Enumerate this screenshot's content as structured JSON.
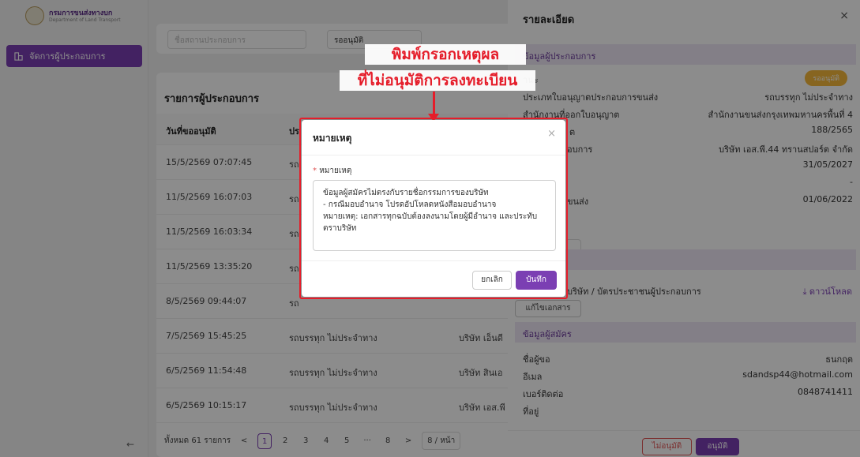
{
  "sidebar": {
    "logo_th": "กรมการขนส่งทางบก",
    "logo_en": "Department of Land Transport",
    "menu_item": "จัดการผู้ประกอบการ",
    "collapse_glyph": "←"
  },
  "filter": {
    "name_placeholder": "ชื่อสถานประกอบการ",
    "status_value": "รออนุมัติ"
  },
  "list": {
    "title": "รายการผู้ประกอบการ",
    "col_date": "วันที่ขออนุมัติ",
    "col_type_partial": "ปร",
    "rows": [
      {
        "date": "15/5/2569 07:07:45",
        "type": "รถ",
        "company": ""
      },
      {
        "date": "11/5/2569 16:07:03",
        "type": "รถ",
        "company": ""
      },
      {
        "date": "11/5/2569 16:03:34",
        "type": "รถ",
        "company": ""
      },
      {
        "date": "11/5/2569 13:35:20",
        "type": "รถ",
        "company": ""
      },
      {
        "date": "8/5/2569 09:44:07",
        "type": "รถ",
        "company": ""
      },
      {
        "date": "7/5/2569 15:45:25",
        "type": "รถบรรทุก ไม่ประจำทาง",
        "company": "บริษัท เอ็นดี"
      },
      {
        "date": "6/5/2569 11:54:48",
        "type": "รถบรรทุก ไม่ประจำทาง",
        "company": "บริษัท สินเอ"
      },
      {
        "date": "6/5/2569 10:15:17",
        "type": "รถบรรทุก ไม่ประจำทาง",
        "company": "บริษัท เอส.พี"
      }
    ],
    "pager": {
      "total": "ทั้งหมด 61 รายการ",
      "prev": "<",
      "pages": [
        "1",
        "2",
        "3",
        "4",
        "5",
        "···",
        "8"
      ],
      "next": ">",
      "size": "8 / หน้า"
    }
  },
  "drawer": {
    "title": "รายละเอียด",
    "close_glyph": "×",
    "section_operator": "ข้อมูลผู้ประกอบการ",
    "status_label_partial": "านะ",
    "status_badge": "รออนุมัติ",
    "license_type_label": "ประเภทใบอนุญาตประกอบการขนส่ง",
    "license_type_value": "รถบรรทุก ไม่ประจำทาง",
    "issuing_office_label": "สำนักงานที่ออกใบอนุญาต",
    "issuing_office_value": "สำนักงานขนส่งกรุงเทพมหานครพื้นที่ 4",
    "label_partial_3": "ต",
    "license_no_value": "188/2565",
    "label_partial_4": "อบการ",
    "company_value": "บริษัท เอส.พี.44 ทรานสปอร์ต จำกัด",
    "expiry_value": "31/05/2027",
    "dash_value": "-",
    "label_partial_7": "ขนส่ง",
    "date_value": "01/06/2022",
    "doc_label_partial": "บริษัท / บัตรประชาชนผู้ประกอบการ",
    "download": "⤓ ดาวน์โหลด",
    "edit_doc_btn": "แก้ไขเอกสาร",
    "section_applicant": "ข้อมูลผู้สมัคร",
    "applicant_name_label": "ชื่อผู้ขอ",
    "applicant_name_value": "ธนกฤต",
    "email_label": "อีเมล",
    "email_value": "sdandsp44@hotmail.com",
    "phone_label": "เบอร์ติดต่อ",
    "phone_value": "0848741411",
    "address_label": "ที่อยู่",
    "btn_reject": "ไม่อนุมัติ",
    "btn_approve": "อนุมัติ"
  },
  "annotation": {
    "line1": "พิมพ์กรอกเหตุผล",
    "line2": "ที่ไม่อนุมัติการลงทะเบียน"
  },
  "modal": {
    "title": "หมายเหตุ",
    "close_glyph": "×",
    "field_required_mark": "*",
    "field_label": "หมายเหตุ",
    "textarea_value": "ข้อมูลผู้สมัครไม่ตรงกับรายชื่อกรรมการของบริษัท\n- กรณีมอบอำนาจ โปรดอัปโหลดหนังสือมอบอำนาจ\nหมายเหตุ: เอกสารทุกฉบับต้องลงนามโดยผู้มีอำนาจ และประทับตราบริษัท",
    "cancel": "ยกเลิก",
    "save": "บันทึก"
  },
  "colors": {
    "accent": "#7b3fb3",
    "annotation_red": "#e51d2a",
    "badge_orange": "#f6b93b"
  }
}
